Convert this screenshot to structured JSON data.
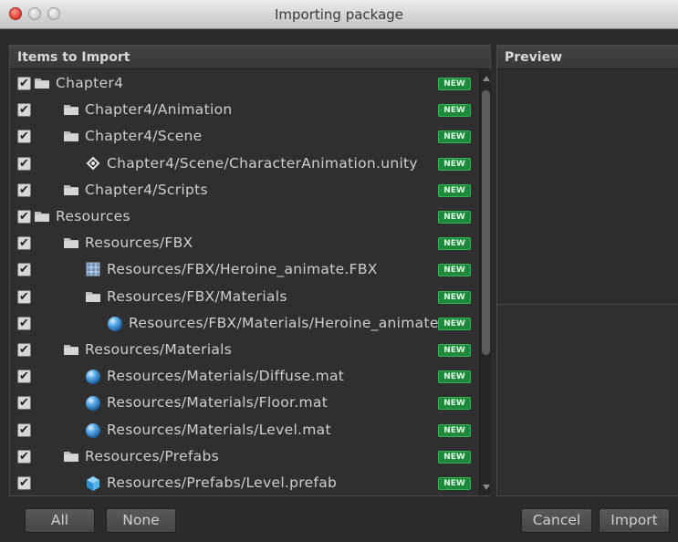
{
  "window": {
    "title": "Importing package"
  },
  "items_panel": {
    "header": "Items to Import"
  },
  "preview_panel": {
    "header": "Preview"
  },
  "new_badge_label": "NEW",
  "items": [
    {
      "label": "Chapter4",
      "icon": "folder-icon",
      "depth": 0,
      "checked": true
    },
    {
      "label": "Chapter4/Animation",
      "icon": "folder-icon",
      "depth": 1,
      "checked": true
    },
    {
      "label": "Chapter4/Scene",
      "icon": "folder-icon",
      "depth": 1,
      "checked": true
    },
    {
      "label": "Chapter4/Scene/CharacterAnimation.unity",
      "icon": "unity-scene-icon",
      "depth": 2,
      "checked": true
    },
    {
      "label": "Chapter4/Scripts",
      "icon": "folder-icon",
      "depth": 1,
      "checked": true
    },
    {
      "label": "Resources",
      "icon": "folder-icon",
      "depth": 0,
      "checked": true
    },
    {
      "label": "Resources/FBX",
      "icon": "folder-icon",
      "depth": 1,
      "checked": true
    },
    {
      "label": "Resources/FBX/Heroine_animate.FBX",
      "icon": "mesh-icon",
      "depth": 2,
      "checked": true
    },
    {
      "label": "Resources/FBX/Materials",
      "icon": "folder-icon",
      "depth": 2,
      "checked": true
    },
    {
      "label": "Resources/FBX/Materials/Heroine_animate",
      "icon": "material-icon",
      "depth": 3,
      "checked": true
    },
    {
      "label": "Resources/Materials",
      "icon": "folder-icon",
      "depth": 1,
      "checked": true
    },
    {
      "label": "Resources/Materials/Diffuse.mat",
      "icon": "material-icon",
      "depth": 2,
      "checked": true
    },
    {
      "label": "Resources/Materials/Floor.mat",
      "icon": "material-icon",
      "depth": 2,
      "checked": true
    },
    {
      "label": "Resources/Materials/Level.mat",
      "icon": "material-icon",
      "depth": 2,
      "checked": true
    },
    {
      "label": "Resources/Prefabs",
      "icon": "folder-icon",
      "depth": 1,
      "checked": true
    },
    {
      "label": "Resources/Prefabs/Level.prefab",
      "icon": "prefab-icon",
      "depth": 2,
      "checked": true
    }
  ],
  "buttons": {
    "all": "All",
    "none": "None",
    "cancel": "Cancel",
    "import": "Import"
  },
  "colors": {
    "new_badge": "#1c8a3a",
    "background": "#2b2b2b"
  }
}
